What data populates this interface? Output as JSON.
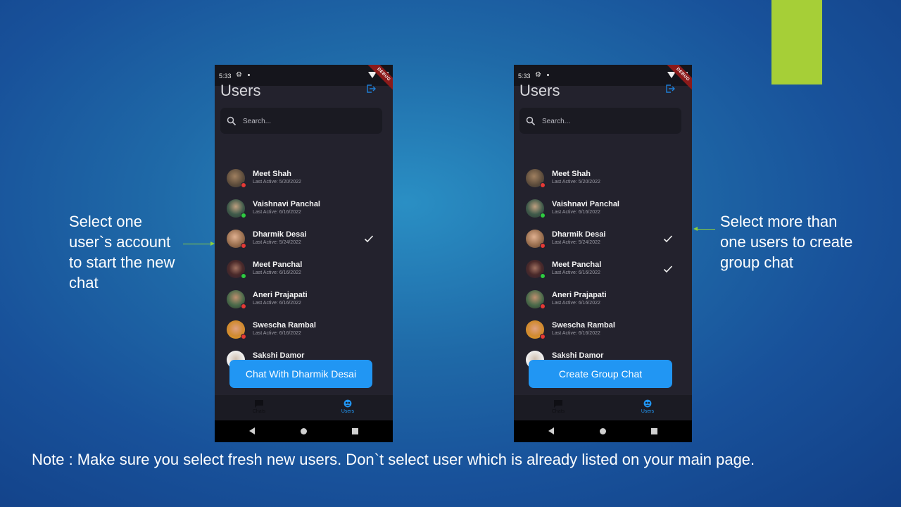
{
  "slide": {
    "left_caption": "Select one user`s account to start the new chat",
    "right_caption": "Select more than one users to create group chat",
    "note": "Note : Make sure you select fresh new users. Don`t select user which is already listed on your main page.",
    "accent_color": "#a6cf37",
    "arrow_color": "#8ccf3c"
  },
  "phone_left": {
    "status": {
      "time": "5:33",
      "debug": "DEBUG"
    },
    "title": "Users",
    "search": {
      "placeholder": "Search..."
    },
    "users": [
      {
        "name": "Meet Shah",
        "active": "Last Active: 5/20/2022",
        "online": false,
        "selected": false
      },
      {
        "name": "Vaishnavi Panchal",
        "active": "Last Active: 6/16/2022",
        "online": true,
        "selected": false
      },
      {
        "name": "Dharmik Desai",
        "active": "Last Active: 5/24/2022",
        "online": false,
        "selected": true
      },
      {
        "name": "Meet Panchal",
        "active": "Last Active: 6/16/2022",
        "online": true,
        "selected": false
      },
      {
        "name": "Aneri Prajapati",
        "active": "Last Active: 6/16/2022",
        "online": false,
        "selected": false
      },
      {
        "name": "Swescha Rambal",
        "active": "Last Active: 6/16/2022",
        "online": false,
        "selected": false
      },
      {
        "name": "Sakshi Damor",
        "active": "",
        "online": false,
        "selected": false
      }
    ],
    "action_button": "Chat With Dharmik Desai",
    "nav": {
      "chats_label": "Chats",
      "users_label": "Users"
    }
  },
  "phone_right": {
    "status": {
      "time": "5:33",
      "debug": "DEBUG"
    },
    "title": "Users",
    "search": {
      "placeholder": "Search..."
    },
    "users": [
      {
        "name": "Meet Shah",
        "active": "Last Active: 5/20/2022",
        "online": false,
        "selected": false
      },
      {
        "name": "Vaishnavi Panchal",
        "active": "Last Active: 6/16/2022",
        "online": true,
        "selected": false
      },
      {
        "name": "Dharmik Desai",
        "active": "Last Active: 5/24/2022",
        "online": false,
        "selected": true
      },
      {
        "name": "Meet Panchal",
        "active": "Last Active: 6/16/2022",
        "online": true,
        "selected": true
      },
      {
        "name": "Aneri Prajapati",
        "active": "Last Active: 6/16/2022",
        "online": false,
        "selected": false
      },
      {
        "name": "Swescha Rambal",
        "active": "Last Active: 6/16/2022",
        "online": false,
        "selected": false
      },
      {
        "name": "Sakshi Damor",
        "active": "",
        "online": false,
        "selected": false
      }
    ],
    "action_button": "Create Group Chat",
    "nav": {
      "chats_label": "Chats",
      "users_label": "Users"
    }
  },
  "colors": {
    "online": "#2ecc40",
    "offline": "#e53935",
    "primary": "#2196f3"
  }
}
